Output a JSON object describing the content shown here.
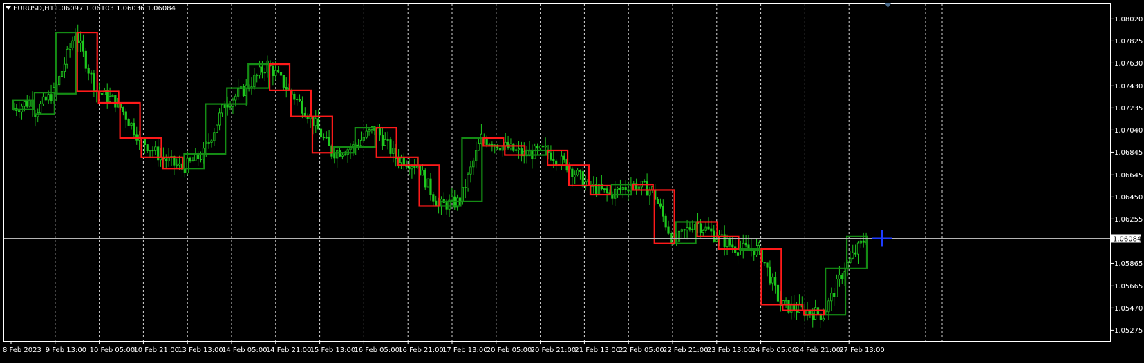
{
  "window": {
    "symbol_label": "EURUSD,H1",
    "ohlc_label": "1.06097 1.06103 1.06036 1.06084"
  },
  "colors": {
    "background": "#000000",
    "grid": "#d9d9d9",
    "axis": "#ffffff",
    "bull": "#1ec81e",
    "bull_box": "#148c14",
    "bear_box": "#ff1a1a",
    "price_line": "#b4b4b4",
    "crosshair": "#1e3cff"
  },
  "chart_data": {
    "type": "candlestick",
    "title": "EURUSD,H1",
    "ylim": [
      1.0518,
      1.0815
    ],
    "y_ticks": [
      "1.08020",
      "1.07825",
      "1.07630",
      "1.07430",
      "1.07235",
      "1.07040",
      "1.06845",
      "1.06645",
      "1.06450",
      "1.06255",
      "1.05865",
      "1.05665",
      "1.05470",
      "1.05275"
    ],
    "current_price": "1.06084",
    "x_labels": [
      "8 Feb 2023",
      "9 Feb 13:00",
      "10 Feb 05:00",
      "10 Feb 21:00",
      "13 Feb 13:00",
      "14 Feb 05:00",
      "14 Feb 21:00",
      "15 Feb 13:00",
      "16 Feb 05:00",
      "16 Feb 21:00",
      "17 Feb 13:00",
      "20 Feb 05:00",
      "20 Feb 21:00",
      "21 Feb 13:00",
      "22 Feb 05:00",
      "22 Feb 21:00",
      "23 Feb 13:00",
      "24 Feb 05:00",
      "24 Feb 21:00",
      "27 Feb 13:00"
    ],
    "grid": true,
    "period_boxes": [
      {
        "o": 1.0722,
        "c": 1.073
      },
      {
        "o": 1.0718,
        "c": 1.0737
      },
      {
        "o": 1.0736,
        "c": 1.079
      },
      {
        "o": 1.079,
        "c": 1.0738
      },
      {
        "o": 1.0738,
        "c": 1.0728
      },
      {
        "o": 1.0728,
        "c": 1.0697
      },
      {
        "o": 1.0697,
        "c": 1.068
      },
      {
        "o": 1.068,
        "c": 1.067
      },
      {
        "o": 1.067,
        "c": 1.0683
      },
      {
        "o": 1.0683,
        "c": 1.0727
      },
      {
        "o": 1.0727,
        "c": 1.0741
      },
      {
        "o": 1.0741,
        "c": 1.0762
      },
      {
        "o": 1.0762,
        "c": 1.0739
      },
      {
        "o": 1.0739,
        "c": 1.0716
      },
      {
        "o": 1.0716,
        "c": 1.0684
      },
      {
        "o": 1.0684,
        "c": 1.0689
      },
      {
        "o": 1.0689,
        "c": 1.0706
      },
      {
        "o": 1.0706,
        "c": 1.068
      },
      {
        "o": 1.068,
        "c": 1.0673
      },
      {
        "o": 1.0673,
        "c": 1.0637
      },
      {
        "o": 1.0637,
        "c": 1.0641
      },
      {
        "o": 1.0641,
        "c": 1.0697
      },
      {
        "o": 1.0697,
        "c": 1.069
      },
      {
        "o": 1.069,
        "c": 1.0682
      },
      {
        "o": 1.0682,
        "c": 1.0686
      },
      {
        "o": 1.0686,
        "c": 1.0673
      },
      {
        "o": 1.0673,
        "c": 1.0655
      },
      {
        "o": 1.0655,
        "c": 1.0647
      },
      {
        "o": 1.0647,
        "c": 1.0656
      },
      {
        "o": 1.0656,
        "c": 1.0651
      },
      {
        "o": 1.0651,
        "c": 1.0604
      },
      {
        "o": 1.0604,
        "c": 1.0623
      },
      {
        "o": 1.0623,
        "c": 1.061
      },
      {
        "o": 1.061,
        "c": 1.0599
      },
      {
        "o": 1.0599,
        "c": 1.0599
      },
      {
        "o": 1.0599,
        "c": 1.055
      },
      {
        "o": 1.055,
        "c": 1.0545
      },
      {
        "o": 1.0545,
        "c": 1.0541
      },
      {
        "o": 1.0541,
        "c": 1.0582
      },
      {
        "o": 1.0582,
        "c": 1.061
      }
    ]
  }
}
